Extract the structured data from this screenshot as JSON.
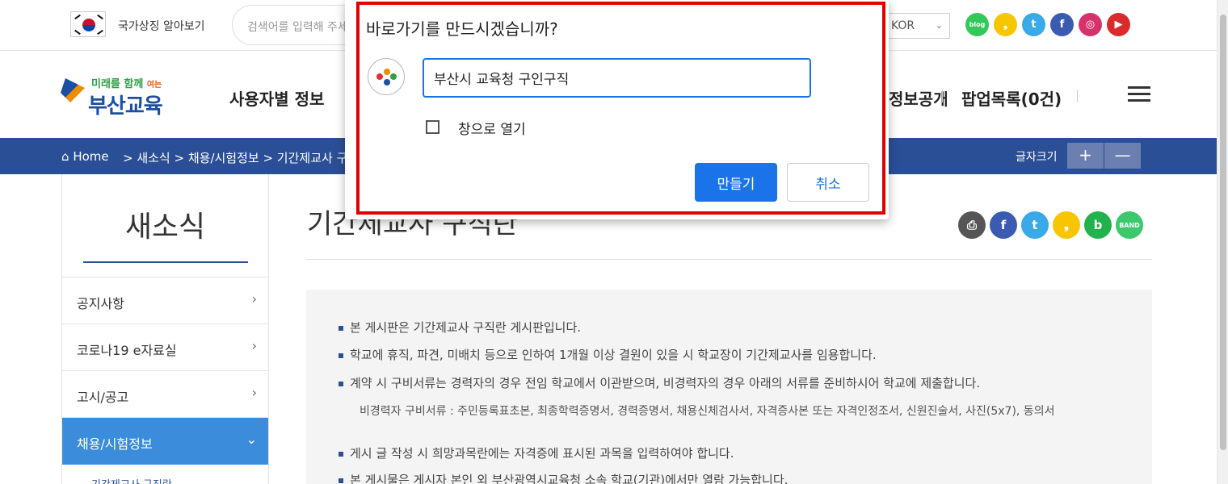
{
  "topbar": {
    "symbol_link": "국가상징 알아보기",
    "search_placeholder": "검색어를 입력해 주세요",
    "language": "KOR",
    "sns": [
      {
        "icon": "blog-icon",
        "label": "blog",
        "color": "#34c759"
      },
      {
        "icon": "kakaostory-icon",
        "label": "❟",
        "color": "#f7c600"
      },
      {
        "icon": "twitter-icon",
        "label": "t",
        "color": "#3aa9e8"
      },
      {
        "icon": "facebook-icon",
        "label": "f",
        "color": "#3b5bb3"
      },
      {
        "icon": "instagram-icon",
        "label": "◎",
        "color": "#d6336c"
      },
      {
        "icon": "youtube-icon",
        "label": "▶",
        "color": "#d92b2b"
      }
    ]
  },
  "header": {
    "logo_slogan": "미래를 함께",
    "logo_slogan_small": "여는",
    "logo_name": "부산교육",
    "nav_first": "사용자별 정보",
    "nav_open": "정보공개",
    "nav_popup": "팝업목록(0건)"
  },
  "breadcrumb": {
    "home": "Home",
    "path": "> 새소식 > 채용/시험정보 > 기간제교사 구직란",
    "font_size_label": "글자크기",
    "plus": "+",
    "minus": "—"
  },
  "sidebar": {
    "title": "새소식",
    "items": [
      {
        "label": "공지사항",
        "active": false
      },
      {
        "label": "코로나19 e자료실",
        "active": false
      },
      {
        "label": "고시/공고",
        "active": false
      },
      {
        "label": "채용/시험정보",
        "active": true
      }
    ],
    "sub_item": "기간제교사 구직란"
  },
  "content": {
    "title": "기간제교사 구직란",
    "share": [
      {
        "icon": "print-icon",
        "label": "⎙",
        "color": "#555555"
      },
      {
        "icon": "facebook-icon",
        "label": "f",
        "color": "#3b5bb3"
      },
      {
        "icon": "twitter-icon",
        "label": "t",
        "color": "#3aa9e8"
      },
      {
        "icon": "kakaostory-icon",
        "label": "❟",
        "color": "#f7c600"
      },
      {
        "icon": "blog-icon",
        "label": "b",
        "color": "#22b14c"
      },
      {
        "icon": "band-icon",
        "label": "BAND",
        "color": "#3cc86d"
      }
    ],
    "notices": [
      "본 게시판은 기간제교사 구직란 게시판입니다.",
      "학교에 휴직, 파견, 미배치 등으로 인하여 1개월 이상 결원이 있을 시 학교장이 기간제교사를 임용합니다.",
      "계약 시 구비서류는 경력자의 경우 전임 학교에서 이관받으며, 비경력자의 경우 아래의 서류를 준비하시어 학교에 제출합니다."
    ],
    "indent_note": "비경력자 구비서류 : 주민등록표초본, 최종학력증명서, 경력증명서, 채용신체검사서, 자격증사본 또는 자격인정조서, 신원진술서, 사진(5x7), 동의서",
    "notices2": [
      "게시 글 작성 시 희망과목란에는 자격증에 표시된 과목을 입력하여야 합니다.",
      "본 게시물은 게시자 본인 외 부산광역시교육청 소속 학교(기관)에서만 열람 가능합니다."
    ]
  },
  "dialog": {
    "title": "바로가기를 만드시겠습니까?",
    "name_value": "부산시 교육청 구인구직",
    "open_as_window": "창으로 열기",
    "open_as_window_checked": false,
    "create_button": "만들기",
    "cancel_button": "취소",
    "highlight_color": "#e00000",
    "accent_color": "#1a73e8"
  }
}
